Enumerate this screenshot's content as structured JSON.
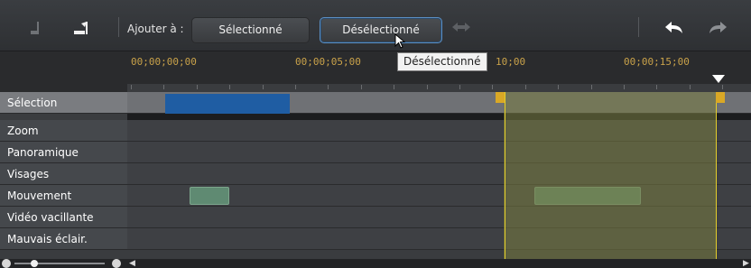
{
  "toolbar": {
    "add_to_label": "Ajouter à :",
    "selected_button": "Sélectionné",
    "deselected_button": "Désélectionné",
    "tooltip": "Désélectionné"
  },
  "ruler": {
    "timecodes": [
      "00;00;00;00",
      "00;00;05;00",
      "10;00",
      "00;00;15;00"
    ]
  },
  "tracks": {
    "labels": [
      "Sélection",
      "Zoom",
      "Panoramique",
      "Visages",
      "Mouvement",
      "Vidéo vacillante",
      "Mauvais éclair."
    ]
  },
  "colors": {
    "selection_block": "#1f5da3",
    "highlight": "#787c40",
    "highlight_edge": "#e6cf2a",
    "motion_clip": "#5f8a72",
    "timecode": "#c9a24a"
  }
}
